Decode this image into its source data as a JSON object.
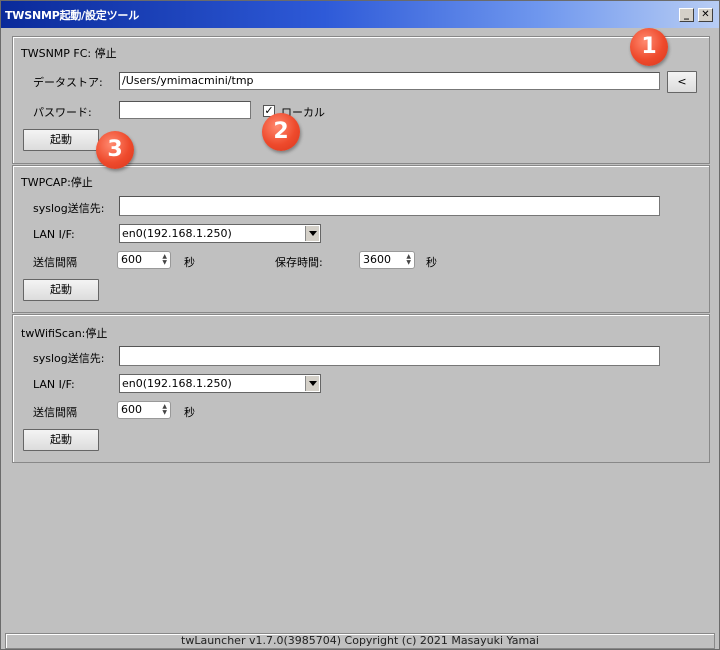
{
  "window": {
    "title": "TWSNMP起動/設定ツール",
    "minimize_glyph": "_",
    "close_glyph": "✕"
  },
  "twsnmp": {
    "title": "TWSNMP FC: 停止",
    "datastore_label": "データストア:",
    "datastore_value": "/Users/ymimacmini/tmp",
    "browse_label": "<",
    "password_label": "パスワード:",
    "password_value": "",
    "local_label": "ローカル",
    "local_checked": true,
    "start_label": "起動"
  },
  "twpcap": {
    "title": "TWPCAP:停止",
    "syslog_label": "syslog送信先:",
    "syslog_value": "",
    "lan_label": "LAN I/F:",
    "lan_value": "en0(192.168.1.250)",
    "interval_label": "送信間隔",
    "interval_value": "600",
    "interval_unit": "秒",
    "retention_label": "保存時間:",
    "retention_value": "3600",
    "retention_unit": "秒",
    "start_label": "起動"
  },
  "twwifiscan": {
    "title": "twWifiScan:停止",
    "syslog_label": "syslog送信先:",
    "syslog_value": "",
    "lan_label": "LAN I/F:",
    "lan_value": "en0(192.168.1.250)",
    "interval_label": "送信間隔",
    "interval_value": "600",
    "interval_unit": "秒",
    "start_label": "起動"
  },
  "markers": [
    "1",
    "2",
    "3"
  ],
  "status_text": "twLauncher v1.7.0(3985704) Copyright (c) 2021 Masayuki Yamai"
}
